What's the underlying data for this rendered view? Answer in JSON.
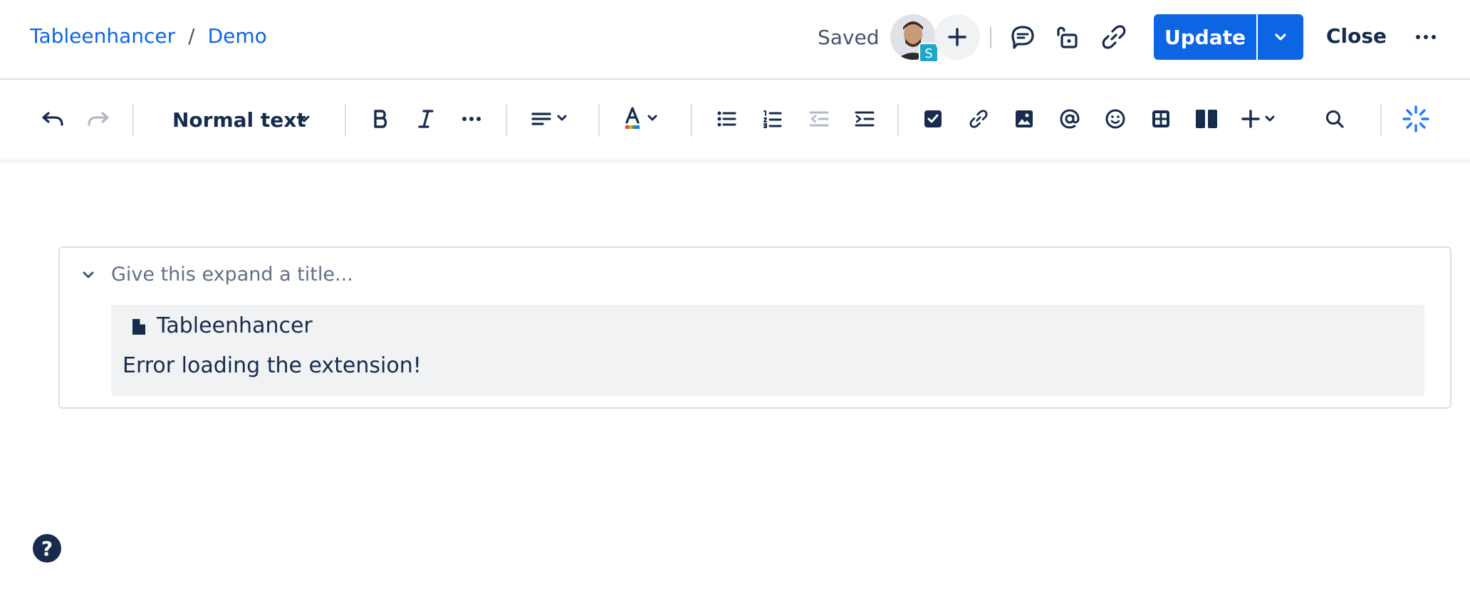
{
  "breadcrumb": {
    "space": "Tableenhancer",
    "separator": "/",
    "page": "Demo"
  },
  "header": {
    "saved_status": "Saved",
    "avatar_badge": "S",
    "update_label": "Update",
    "close_label": "Close"
  },
  "toolbar": {
    "text_style": "Normal text",
    "icons": [
      "undo-icon",
      "redo-icon",
      "bold-icon",
      "italic-icon",
      "more-formatting-icon",
      "align-icon",
      "text-color-icon",
      "bullet-list-icon",
      "numbered-list-icon",
      "outdent-icon",
      "indent-icon",
      "task-icon",
      "link-icon",
      "image-icon",
      "mention-icon",
      "emoji-icon",
      "table-icon",
      "layout-icon",
      "insert-icon",
      "search-icon",
      "ai-icon"
    ]
  },
  "content": {
    "expand_placeholder": "Give this expand a title...",
    "extension_name": "Tableenhancer",
    "extension_error": "Error loading the extension!"
  },
  "help": {
    "label": "?"
  },
  "colors": {
    "primary": "#0c66e4",
    "text": "#172b4d",
    "subtle": "#626f86",
    "badge": "#1fa7c9"
  }
}
